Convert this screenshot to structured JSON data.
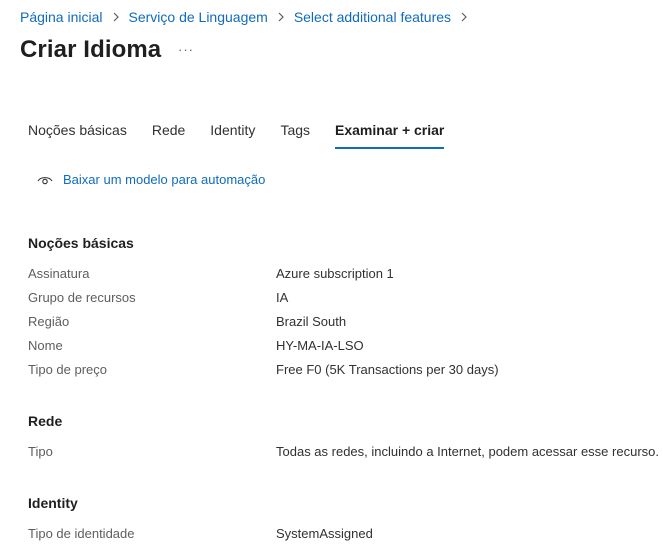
{
  "breadcrumb": [
    {
      "label": "Página inicial"
    },
    {
      "label": "Serviço de Linguagem"
    },
    {
      "label": "Select additional features"
    }
  ],
  "page": {
    "title": "Criar Idioma",
    "more_label": "···"
  },
  "tabs": [
    {
      "label": "Noções básicas"
    },
    {
      "label": "Rede"
    },
    {
      "label": "Identity"
    },
    {
      "label": "Tags"
    },
    {
      "label": "Examinar + criar",
      "active": true
    }
  ],
  "download_link": {
    "label": "Baixar um modelo para automação",
    "icon": "eye-icon"
  },
  "sections": {
    "basics": {
      "title": "Noções básicas",
      "rows": [
        {
          "label": "Assinatura",
          "value": "Azure subscription 1"
        },
        {
          "label": "Grupo de recursos",
          "value": "IA"
        },
        {
          "label": "Região",
          "value": "Brazil South"
        },
        {
          "label": "Nome",
          "value": "HY-MA-IA-LSO"
        },
        {
          "label": "Tipo de preço",
          "value": "Free F0 (5K Transactions per 30 days)"
        }
      ]
    },
    "network": {
      "title": "Rede",
      "rows": [
        {
          "label": "Tipo",
          "value": "Todas as redes, incluindo a Internet, podem acessar esse recurso."
        }
      ]
    },
    "identity": {
      "title": "Identity",
      "rows": [
        {
          "label": "Tipo de identidade",
          "value": "SystemAssigned"
        }
      ]
    }
  },
  "colors": {
    "link": "#0f6cbd",
    "active_tab_underline": "#0f6cbd",
    "label_text": "#605e5c",
    "body_text": "#323130"
  }
}
